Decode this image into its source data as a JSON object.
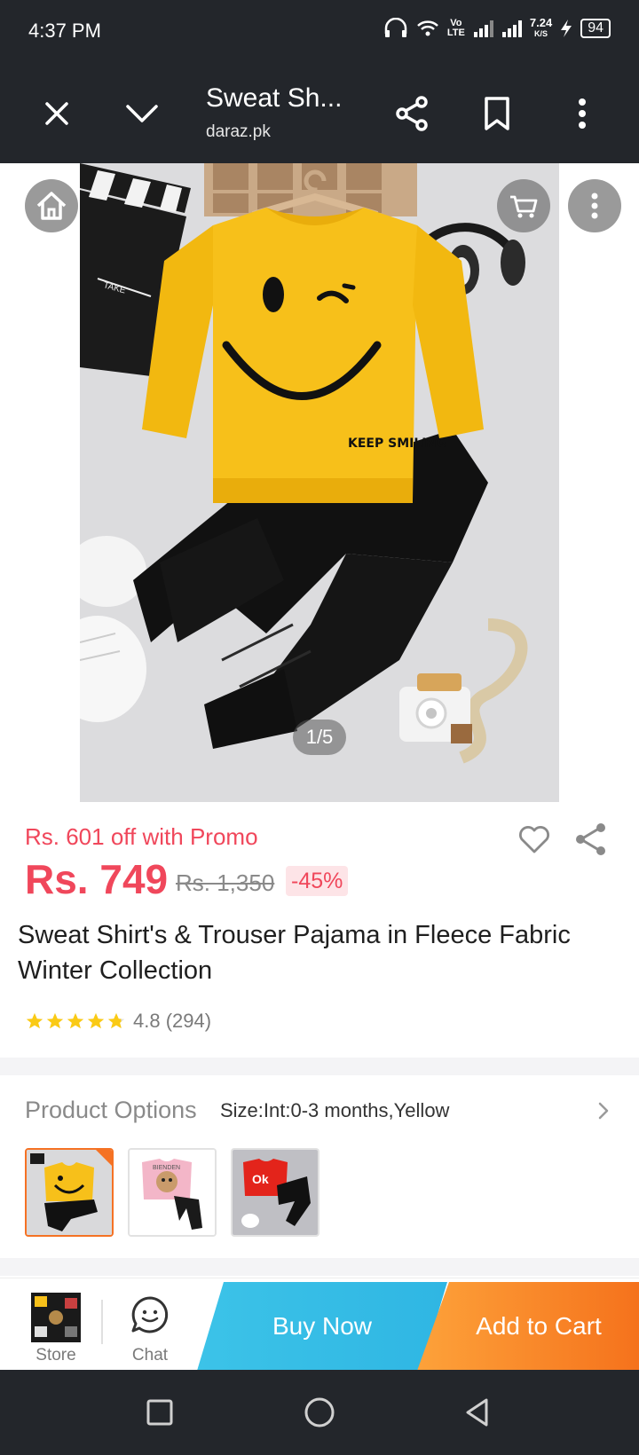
{
  "status_bar": {
    "time": "4:37 PM",
    "network_speed": "7.24",
    "network_unit": "K/S",
    "volte": "Vo LTE",
    "battery": "94"
  },
  "toolbar": {
    "title": "Sweat Sh...",
    "subtitle": "daraz.pk",
    "icons": [
      "close-icon",
      "chevron-down-icon",
      "share-icon",
      "bookmark-icon",
      "more-vert-icon"
    ]
  },
  "gallery": {
    "counter": "1/5",
    "overlay_icons": [
      "home-icon",
      "cart-icon",
      "more-vert-icon"
    ],
    "print_text": "KEEP SMILING",
    "clapper_text": "TAKE"
  },
  "product": {
    "promo_text": "Rs. 601 off with Promo",
    "price": "Rs. 749",
    "original_price": "Rs. 1,350",
    "discount": "-45%",
    "title": "Sweat Shirt's & Trouser Pajama in Fleece Fabric Winter Collection",
    "rating_value": 4.8,
    "rating_text": "4.8 (294)",
    "accent_color": "#f0475b"
  },
  "options": {
    "label": "Product Options",
    "value": "Size:Int:0-3 months,Yellow",
    "thumbnails": [
      {
        "name": "yellow",
        "selected": true
      },
      {
        "name": "pink",
        "selected": false,
        "text": "BIENDEN"
      },
      {
        "name": "red",
        "selected": false,
        "text": "Ok"
      }
    ]
  },
  "action_bar": {
    "store_label": "Store",
    "chat_label": "Chat",
    "buy_now": "Buy Now",
    "add_to_cart": "Add to Cart",
    "buy_now_color": "#2fb6e3",
    "add_to_cart_color": "#f5721c"
  },
  "system_nav": {
    "icons": [
      "recent-apps-icon",
      "home-circle-icon",
      "back-icon"
    ]
  }
}
